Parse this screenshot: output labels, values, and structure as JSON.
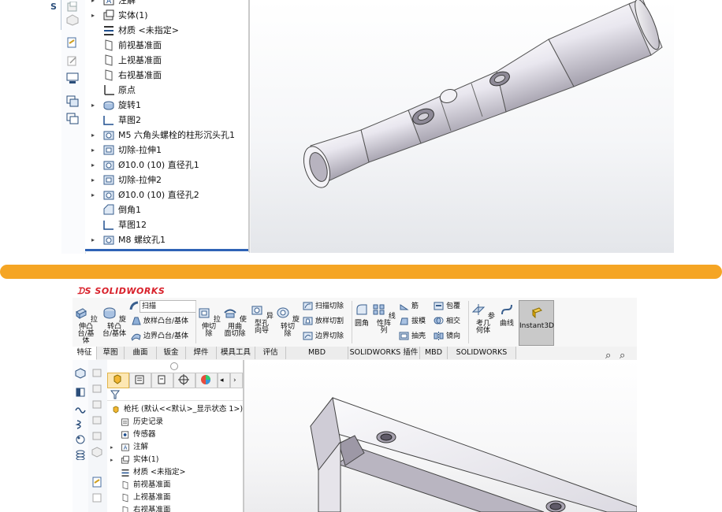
{
  "top_panel": {
    "strip_glyph": "S",
    "tree_items": [
      {
        "label": "注解",
        "icon": "annotation-icon",
        "arrow": "▸"
      },
      {
        "label": "实体(1)",
        "icon": "solid-bodies-icon",
        "arrow": "▸"
      },
      {
        "label": "材质 <未指定>",
        "icon": "material-icon",
        "arrow": ""
      },
      {
        "label": "前视基准面",
        "icon": "plane-icon",
        "arrow": ""
      },
      {
        "label": "上视基准面",
        "icon": "plane-icon",
        "arrow": ""
      },
      {
        "label": "右视基准面",
        "icon": "plane-icon",
        "arrow": ""
      },
      {
        "label": "原点",
        "icon": "origin-icon",
        "arrow": ""
      },
      {
        "label": "旋转1",
        "icon": "revolve-feature-icon",
        "arrow": "▸"
      },
      {
        "label": "草图2",
        "icon": "sketch-icon",
        "arrow": ""
      },
      {
        "label": "M5 六角头螺栓的柱形沉头孔1",
        "icon": "hole-wizard-icon",
        "arrow": "▸"
      },
      {
        "label": "切除-拉伸1",
        "icon": "cut-extrude-icon",
        "arrow": "▸"
      },
      {
        "label": "Ø10.0 (10) 直径孔1",
        "icon": "hole-wizard-icon",
        "arrow": "▸"
      },
      {
        "label": "切除-拉伸2",
        "icon": "cut-extrude-icon",
        "arrow": "▸"
      },
      {
        "label": "Ø10.0 (10) 直径孔2",
        "icon": "hole-wizard-icon",
        "arrow": "▸"
      },
      {
        "label": "倒角1",
        "icon": "chamfer-icon",
        "arrow": ""
      },
      {
        "label": "草图12",
        "icon": "sketch-icon",
        "arrow": ""
      },
      {
        "label": "M8 螺纹孔1",
        "icon": "hole-wizard-icon",
        "arrow": "▸"
      }
    ]
  },
  "bottom_panel": {
    "logo_text": "SOLIDWORKS",
    "ribbon": {
      "extrude_boss": "拉伸凸\n台/基体",
      "revolve_boss": "旋转凸\n台/基体",
      "sweep": "扫描",
      "loft_boss": "放样凸台/基体",
      "boundary_boss": "边界凸台/基体",
      "extrude_cut": "拉伸切\n除",
      "surface_cut": "使用曲\n面切除",
      "hole_wizard": "异型孔\n向导",
      "revolve_cut": "旋转切\n除",
      "sweep_cut": "扫描切除",
      "loft_cut": "放样切割",
      "boundary_cut": "边界切除",
      "fillet": "圆角",
      "linear_pattern": "线性阵\n列",
      "rib": "筋",
      "draft": "拔模",
      "shell": "抽壳",
      "wrap": "包覆",
      "intersect": "相交",
      "mirror": "镜向",
      "ref_geometry": "参考几\n何体",
      "curves": "曲线",
      "instant3d": "Instant3D"
    },
    "tabs": [
      "特征",
      "草图",
      "曲面",
      "钣金",
      "焊件",
      "模具工具",
      "评估",
      "MBD Dimensions",
      "SOLIDWORKS 插件",
      "MBD",
      "SOLIDWORKS CAM"
    ],
    "active_tab": "特征",
    "tree_items": [
      {
        "label": "枪托 (默认<<默认>_显示状态 1>)",
        "icon": "part-icon",
        "arrow": ""
      },
      {
        "label": "历史记录",
        "icon": "history-icon",
        "arrow": ""
      },
      {
        "label": "传感器",
        "icon": "sensor-icon",
        "arrow": ""
      },
      {
        "label": "注解",
        "icon": "annotation-icon",
        "arrow": "▸"
      },
      {
        "label": "实体(1)",
        "icon": "solid-bodies-icon",
        "arrow": "▸"
      },
      {
        "label": "材质 <未指定>",
        "icon": "material-icon",
        "arrow": ""
      },
      {
        "label": "前视基准面",
        "icon": "plane-icon",
        "arrow": ""
      },
      {
        "label": "上视基准面",
        "icon": "plane-icon",
        "arrow": ""
      },
      {
        "label": "右视基准面",
        "icon": "plane-icon",
        "arrow": ""
      }
    ]
  },
  "colors": {
    "separator": "#f5a524",
    "selection_blue": "#2f63b6",
    "logo_red": "#d8202a"
  }
}
